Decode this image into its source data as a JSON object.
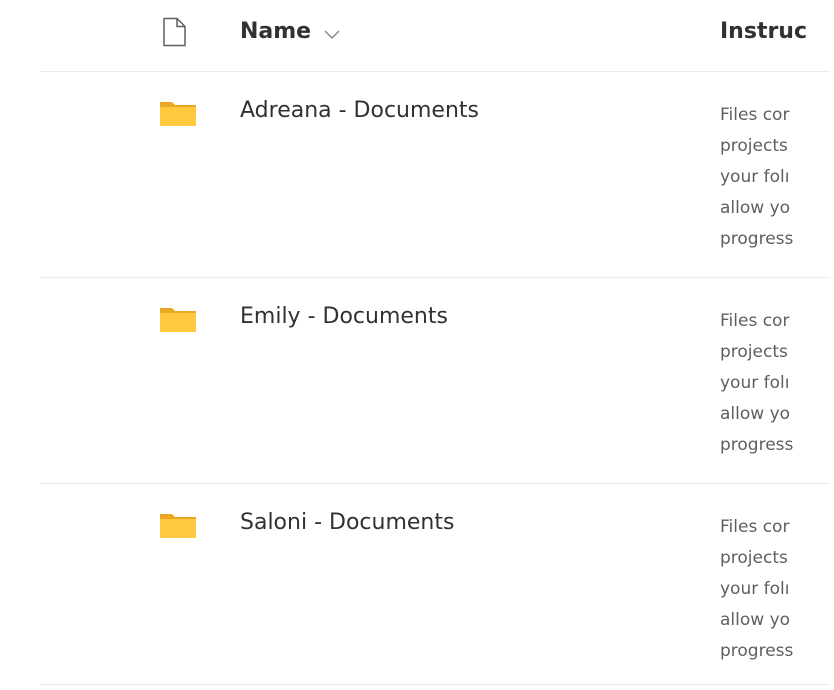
{
  "header": {
    "name_label": "Name",
    "instructions_label": "Instruc"
  },
  "rows": [
    {
      "name": "Adreana - Documents",
      "desc_lines": [
        "Files cor",
        "projects",
        "your folı",
        "allow yo",
        "progress"
      ]
    },
    {
      "name": "Emily - Documents",
      "desc_lines": [
        "Files cor",
        "projects",
        "your folı",
        "allow yo",
        "progress"
      ]
    },
    {
      "name": "Saloni - Documents",
      "desc_lines": [
        "Files cor",
        "projects",
        "your folı",
        "allow yo",
        "progress"
      ]
    }
  ],
  "colors": {
    "folder": "#ffc83d",
    "folder_dark": "#e8a825",
    "divider": "#edebe9",
    "text": "#323130",
    "desc_text": "#605e5c"
  },
  "icons": {
    "header_file": "document-icon",
    "sort": "chevron-down-icon",
    "folder": "folder-icon"
  }
}
